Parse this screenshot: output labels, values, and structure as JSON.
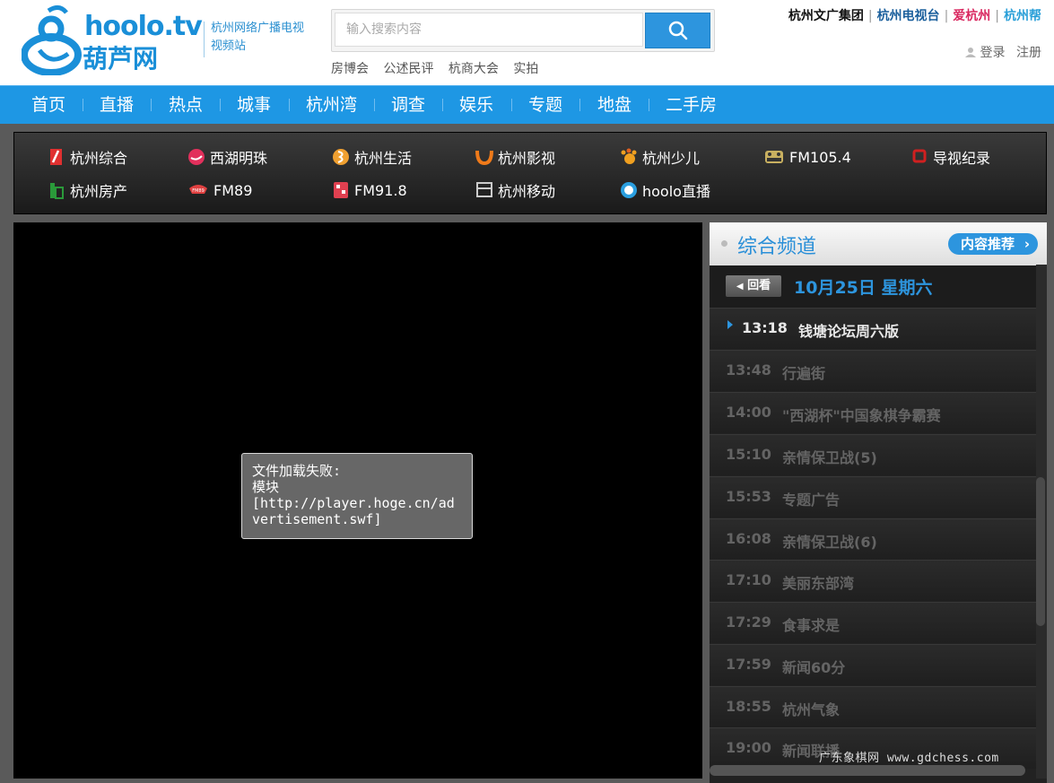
{
  "header": {
    "logo_text": "hoolo.tv",
    "logo_sub": "葫芦网",
    "site_desc": "杭州网络广播电视视频站",
    "search_placeholder": "输入搜索内容",
    "hot_links": [
      "房博会",
      "公述民评",
      "杭商大会",
      "实拍"
    ],
    "top_links": [
      {
        "label": "杭州文广集团",
        "color": "#111111"
      },
      {
        "label": "杭州电视台",
        "color": "#1a5f9c"
      },
      {
        "label": "爱杭州",
        "color": "#d9275f"
      },
      {
        "label": "杭州帮",
        "color": "#2a9fd8"
      }
    ],
    "login": "登录",
    "register": "注册"
  },
  "nav": {
    "items": [
      "首页",
      "直播",
      "热点",
      "城事",
      "杭州湾",
      "调查",
      "娱乐",
      "专题",
      "地盘",
      "二手房"
    ]
  },
  "channels": [
    {
      "label": "杭州综合",
      "icon": "zonghe-logo-icon",
      "color": "#e03030"
    },
    {
      "label": "西湖明珠",
      "icon": "xihu-logo-icon",
      "color": "#e2305c"
    },
    {
      "label": "杭州生活",
      "icon": "shenghuo-logo-icon",
      "color": "#f0a030"
    },
    {
      "label": "杭州影视",
      "icon": "yingshi-logo-icon",
      "color": "#ef7a1a"
    },
    {
      "label": "杭州少儿",
      "icon": "shaoer-logo-icon",
      "color": "#f0a020"
    },
    {
      "label": "FM105.4",
      "icon": "fm1054-logo-icon",
      "color": "#c8b060"
    },
    {
      "label": "导视纪录",
      "icon": "jilu-logo-icon",
      "color": "#d02020"
    },
    {
      "label": "杭州房产",
      "icon": "fangchan-logo-icon",
      "color": "#2a9a3a"
    },
    {
      "label": "FM89",
      "icon": "fm89-logo-icon",
      "color": "#e04040"
    },
    {
      "label": "FM91.8",
      "icon": "fm918-logo-icon",
      "color": "#e04050"
    },
    {
      "label": "杭州移动",
      "icon": "yidong-logo-icon",
      "color": "#cccccc"
    },
    {
      "label": "hoolo直播",
      "icon": "hoolo-live-icon",
      "color": "#2a9fe0"
    }
  ],
  "player": {
    "error_text": "文件加载失败:\n模块\n[http://player.hoge.cn/advertisement.swf]"
  },
  "side": {
    "title": "综合频道",
    "recommend": "内容推荐",
    "back_label": "回看",
    "date": "10月25日 星期六",
    "current": {
      "time": "13:18",
      "name": "钱塘论坛周六版"
    },
    "programs": [
      {
        "time": "13:48",
        "name": "行遍街"
      },
      {
        "time": "14:00",
        "name": "\"西湖杯\"中国象棋争霸赛"
      },
      {
        "time": "15:10",
        "name": "亲情保卫战(5)"
      },
      {
        "time": "15:53",
        "name": "专题广告"
      },
      {
        "time": "16:08",
        "name": "亲情保卫战(6)"
      },
      {
        "time": "17:10",
        "name": "美丽东部湾"
      },
      {
        "time": "17:29",
        "name": "食事求是"
      },
      {
        "time": "17:59",
        "name": "新闻60分"
      },
      {
        "time": "18:55",
        "name": "杭州气象"
      },
      {
        "time": "19:00",
        "name": "新闻联播"
      }
    ]
  },
  "watermark": "广东象棋网 www.gdchess.com"
}
